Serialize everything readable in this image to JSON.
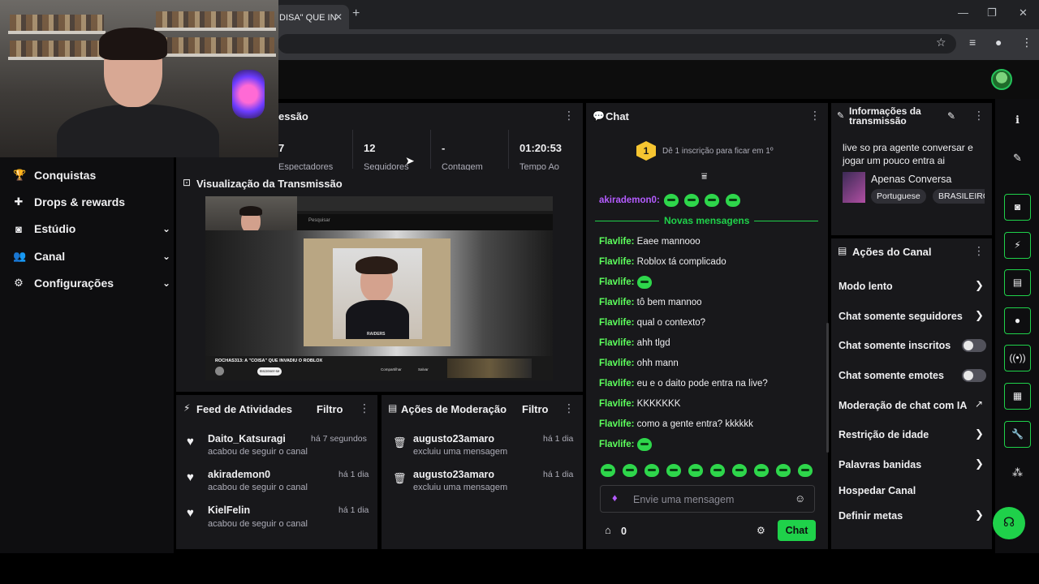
{
  "browser": {
    "tab_title": "DISA\" QUE IN",
    "tab_close": "✕",
    "new_tab": "+",
    "minimize": "—",
    "maximize": "❐",
    "close": "✕"
  },
  "nav": {
    "items": [
      {
        "label": "Conquistas",
        "icon": "trophy-icon",
        "glyph": "🏆"
      },
      {
        "label": "Drops & rewards",
        "icon": "gift-icon",
        "glyph": "✚"
      },
      {
        "label": "Estúdio",
        "icon": "studio-icon",
        "glyph": "◙"
      },
      {
        "label": "Canal",
        "icon": "users-icon",
        "glyph": "👥"
      },
      {
        "label": "Configurações",
        "icon": "gear-icon",
        "glyph": "⚙"
      }
    ],
    "chevron": "⌄"
  },
  "session": {
    "title": "essão",
    "stats": [
      {
        "value": "7",
        "label": "Espectadores"
      },
      {
        "value": "12",
        "label": "Seguidores"
      },
      {
        "value": "-",
        "label": "Contagem"
      },
      {
        "value": "01:20:53",
        "label": "Tempo Ao"
      }
    ]
  },
  "preview": {
    "title": "Visualização da Transmissão",
    "video_caption": "ROCHAS313: A \"COISA\" QUE INVADIU O ROBLOX",
    "search_placeholder": "Pesquisar",
    "shirt_text": "RAIDERS",
    "actions": [
      "Compartilhar",
      "Salvar"
    ],
    "subscribe": "Inscrever-se"
  },
  "activity_feed": {
    "title": "Feed de Atividades",
    "filter": "Filtro",
    "items": [
      {
        "name": "Daito_Katsuragi",
        "time": "há 7 segundos",
        "sub": "acabou de seguir o canal"
      },
      {
        "name": "akirademon0",
        "time": "há 1 dia",
        "sub": "acabou de seguir o canal"
      },
      {
        "name": "KielFelin",
        "time": "há 1 dia",
        "sub": "acabou de seguir o canal"
      }
    ]
  },
  "mod_actions": {
    "title": "Ações de Moderação",
    "filter": "Filtro",
    "items": [
      {
        "name": "augusto23amaro",
        "time": "há 1 dia",
        "sub": "excluiu uma mensagem"
      },
      {
        "name": "augusto23amaro",
        "time": "há 1 dia",
        "sub": "excluiu uma mensagem"
      }
    ]
  },
  "chat": {
    "title": "Chat",
    "sub_goal": "Dê 1 inscrição para ficar em 1º",
    "rank": "1",
    "first_user": "akirademon0:",
    "new_messages": "Novas mensagens",
    "messages": [
      {
        "user": "Flavlife:",
        "text": "Eaee mannooo"
      },
      {
        "user": "Flavlife:",
        "text": "Roblox tá complicado"
      },
      {
        "user": "Flavlife:",
        "text": ""
      },
      {
        "user": "Flavlife:",
        "text": "tô bem mannoo"
      },
      {
        "user": "Flavlife:",
        "text": "qual o contexto?"
      },
      {
        "user": "Flavlife:",
        "text": "ahh tlgd"
      },
      {
        "user": "Flavlife:",
        "text": "ohh mann"
      },
      {
        "user": "Flavlife:",
        "text": "eu e o daito pode entra na live?"
      },
      {
        "user": "Flavlife:",
        "text": "KKKKKKK"
      },
      {
        "user": "Flavlife:",
        "text": "como a gente entra? kkkkkk"
      },
      {
        "user": "Flavlife:",
        "text": ""
      }
    ],
    "input_placeholder": "Envie uma mensagem",
    "points": "0",
    "send_label": "Chat"
  },
  "stream_info": {
    "title": "Informações da transmissão",
    "stream_title": "live so pra agente conversar e jogar um pouco entra ai",
    "category": "Apenas Conversa",
    "tags": [
      "Portuguese",
      "BRASILEIRO"
    ]
  },
  "channel_actions": {
    "title": "Ações do Canal",
    "items": [
      {
        "label": "Modo lento",
        "control": "chevron"
      },
      {
        "label": "Chat somente seguidores",
        "control": "chevron"
      },
      {
        "label": "Chat somente inscritos",
        "control": "toggle"
      },
      {
        "label": "Chat somente emotes",
        "control": "toggle"
      },
      {
        "label": "Moderação de chat com IA",
        "control": "external"
      },
      {
        "label": "Restrição de idade",
        "control": "chevron"
      },
      {
        "label": "Palavras banidas",
        "control": "chevron"
      },
      {
        "label": "Hospedar Canal",
        "control": "none"
      },
      {
        "label": "Definir metas",
        "control": "chevron"
      }
    ]
  },
  "rail": {
    "buttons": [
      "info-icon",
      "pencil-icon",
      "camera-icon",
      "bolt-icon",
      "notes-icon",
      "chat-icon",
      "broadcast-icon",
      "layout-icon",
      "wrench-icon",
      "share-icon"
    ]
  },
  "colors": {
    "accent": "#1fd14a",
    "chat_user": "#5dff5d",
    "mention_user": "#b45cff",
    "panel": "#18181b"
  }
}
